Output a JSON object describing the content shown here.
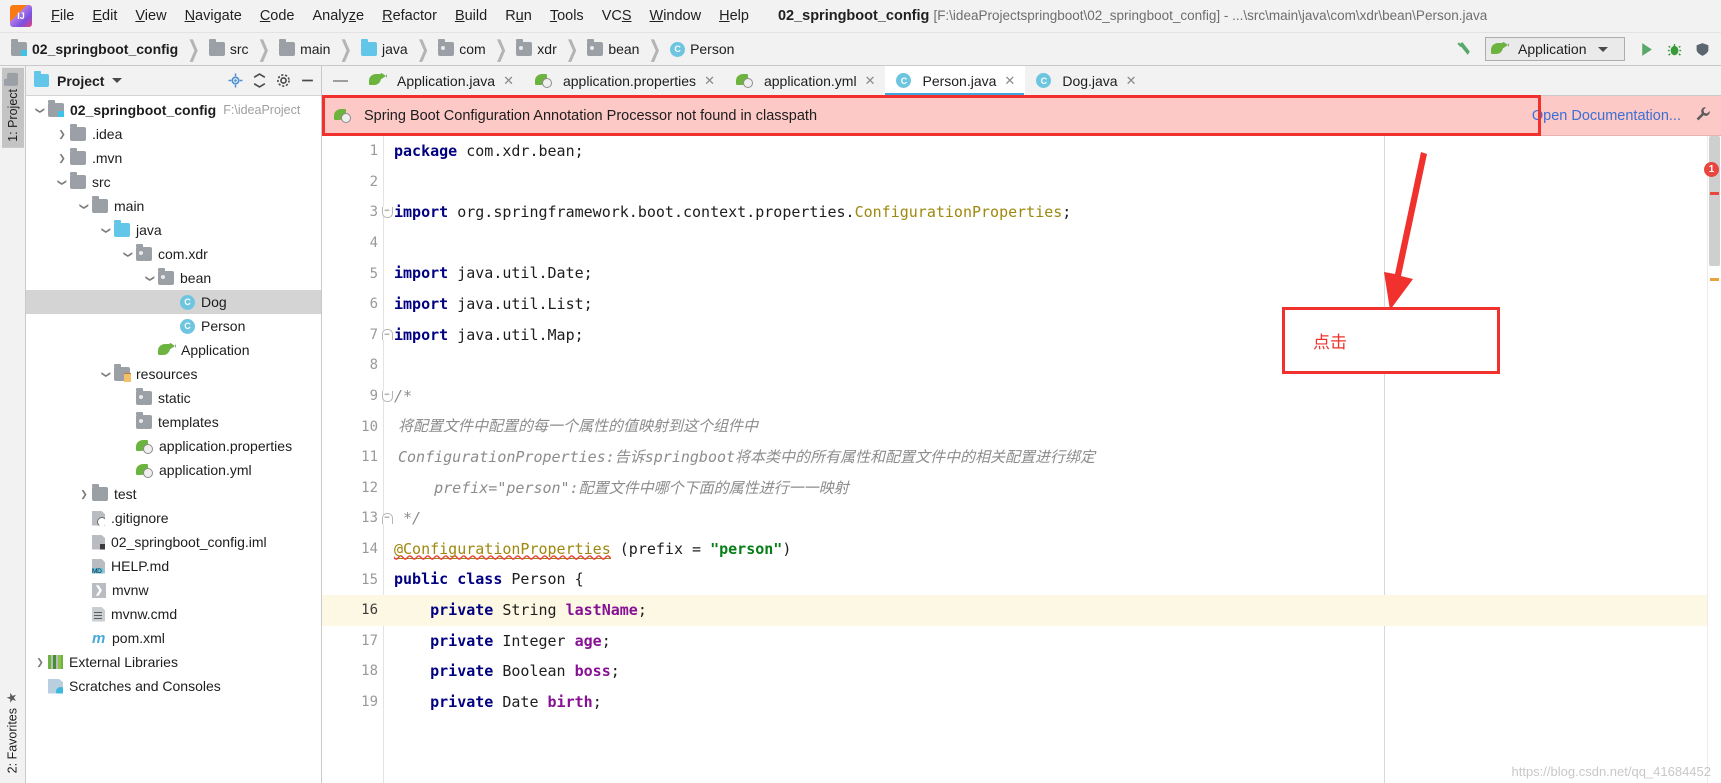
{
  "titlebar": {
    "logo_icon": "intellij-idea-logo",
    "menus": [
      {
        "label": "File",
        "mnemonic": "F"
      },
      {
        "label": "Edit",
        "mnemonic": "E"
      },
      {
        "label": "View",
        "mnemonic": "V"
      },
      {
        "label": "Navigate",
        "mnemonic": "N"
      },
      {
        "label": "Code",
        "mnemonic": "C"
      },
      {
        "label": "Analyze",
        "mnemonic": "z"
      },
      {
        "label": "Refactor",
        "mnemonic": "R"
      },
      {
        "label": "Build",
        "mnemonic": "B"
      },
      {
        "label": "Run",
        "mnemonic": "u"
      },
      {
        "label": "Tools",
        "mnemonic": "T"
      },
      {
        "label": "VCS",
        "mnemonic": "S"
      },
      {
        "label": "Window",
        "mnemonic": "W"
      },
      {
        "label": "Help",
        "mnemonic": "H"
      }
    ],
    "project_name": "02_springboot_config",
    "window_path": "[F:\\ideaProjectspringboot\\02_springboot_config] - ...\\src\\main\\java\\com\\xdr\\bean\\Person.java"
  },
  "breadcrumb": [
    {
      "label": "02_springboot_config",
      "icon": "source-root-folder-icon",
      "bold": true
    },
    {
      "label": "src",
      "icon": "folder-icon",
      "bold": false
    },
    {
      "label": "main",
      "icon": "folder-icon",
      "bold": false
    },
    {
      "label": "java",
      "icon": "source-folder-icon",
      "bold": false
    },
    {
      "label": "com",
      "icon": "package-icon",
      "bold": false
    },
    {
      "label": "xdr",
      "icon": "package-icon",
      "bold": false
    },
    {
      "label": "bean",
      "icon": "package-icon",
      "bold": false
    },
    {
      "label": "Person",
      "icon": "java-class-icon",
      "bold": false
    }
  ],
  "toolbar": {
    "build_icon": "hammer-icon",
    "run_config_label": "Application",
    "run_config_icon": "spring-boot-run-icon",
    "run_icon": "run-play-icon",
    "debug_icon": "debug-bug-icon",
    "coverage_icon": "coverage-shield-icon"
  },
  "project_panel": {
    "title": "Project",
    "title_chevron": "chevron-down-icon",
    "header_icons": [
      "locate-target-icon",
      "collapse-all-icon",
      "settings-gear-icon",
      "hide-minus-icon"
    ],
    "tree": [
      {
        "label": "02_springboot_config",
        "suffix": "F:\\ideaProject",
        "icon": "source-root-folder-icon",
        "twist": "down",
        "indent": 0,
        "bold": true,
        "selected": false
      },
      {
        "label": ".idea",
        "icon": "folder-icon",
        "twist": "right",
        "indent": 1,
        "bold": false,
        "selected": false
      },
      {
        "label": ".mvn",
        "icon": "folder-icon",
        "twist": "right",
        "indent": 1,
        "bold": false,
        "selected": false
      },
      {
        "label": "src",
        "icon": "folder-icon",
        "twist": "down",
        "indent": 1,
        "bold": false,
        "selected": false
      },
      {
        "label": "main",
        "icon": "folder-icon",
        "twist": "down",
        "indent": 2,
        "bold": false,
        "selected": false
      },
      {
        "label": "java",
        "icon": "source-folder-icon",
        "twist": "down",
        "indent": 3,
        "bold": false,
        "selected": false
      },
      {
        "label": "com.xdr",
        "icon": "package-icon",
        "twist": "down",
        "indent": 4,
        "bold": false,
        "selected": false
      },
      {
        "label": "bean",
        "icon": "package-icon",
        "twist": "down",
        "indent": 5,
        "bold": false,
        "selected": false
      },
      {
        "label": "Dog",
        "icon": "java-class-icon",
        "twist": "none",
        "indent": 6,
        "bold": false,
        "selected": true
      },
      {
        "label": "Person",
        "icon": "java-class-icon",
        "twist": "none",
        "indent": 6,
        "bold": false,
        "selected": false
      },
      {
        "label": "Application",
        "icon": "spring-boot-run-icon",
        "twist": "none",
        "indent": 5,
        "bold": false,
        "selected": false
      },
      {
        "label": "resources",
        "icon": "resource-folder-icon",
        "twist": "down",
        "indent": 3,
        "bold": false,
        "selected": false
      },
      {
        "label": "static",
        "icon": "package-icon",
        "twist": "none",
        "indent": 4,
        "bold": false,
        "selected": false
      },
      {
        "label": "templates",
        "icon": "package-icon",
        "twist": "none",
        "indent": 4,
        "bold": false,
        "selected": false
      },
      {
        "label": "application.properties",
        "icon": "spring-config-icon",
        "twist": "none",
        "indent": 4,
        "bold": false,
        "selected": false
      },
      {
        "label": "application.yml",
        "icon": "spring-config-icon",
        "twist": "none",
        "indent": 4,
        "bold": false,
        "selected": false
      },
      {
        "label": "test",
        "icon": "folder-icon",
        "twist": "right",
        "indent": 2,
        "bold": false,
        "selected": false
      },
      {
        "label": ".gitignore",
        "icon": "gitignore-file-icon",
        "twist": "none",
        "indent": 2,
        "bold": false,
        "selected": false
      },
      {
        "label": "02_springboot_config.iml",
        "icon": "iml-file-icon",
        "twist": "none",
        "indent": 2,
        "bold": false,
        "selected": false
      },
      {
        "label": "HELP.md",
        "icon": "markdown-file-icon",
        "twist": "none",
        "indent": 2,
        "bold": false,
        "selected": false
      },
      {
        "label": "mvnw",
        "icon": "shell-script-icon",
        "twist": "none",
        "indent": 2,
        "bold": false,
        "selected": false
      },
      {
        "label": "mvnw.cmd",
        "icon": "cmd-script-icon",
        "twist": "none",
        "indent": 2,
        "bold": false,
        "selected": false
      },
      {
        "label": "pom.xml",
        "icon": "maven-file-icon",
        "twist": "none",
        "indent": 2,
        "bold": false,
        "selected": false
      },
      {
        "label": "External Libraries",
        "icon": "libraries-icon",
        "twist": "right",
        "indent": 0,
        "bold": false,
        "selected": false
      },
      {
        "label": "Scratches and Consoles",
        "icon": "scratches-icon",
        "twist": "none",
        "indent": 0,
        "bold": false,
        "selected": false
      }
    ]
  },
  "tool_window_tabs": {
    "project": "1: Project",
    "favorites": "2: Favorites"
  },
  "editor_tabs": [
    {
      "label": "Application.java",
      "icon": "spring-boot-run-icon",
      "active": false
    },
    {
      "label": "application.properties",
      "icon": "spring-config-icon",
      "active": false
    },
    {
      "label": "application.yml",
      "icon": "spring-config-icon",
      "active": false
    },
    {
      "label": "Person.java",
      "icon": "java-class-icon",
      "active": true
    },
    {
      "label": "Dog.java",
      "icon": "java-class-icon",
      "active": false
    }
  ],
  "warning_banner": {
    "icon": "spring-boot-leaf-icon",
    "message": "Spring Boot Configuration Annotation Processor not found in classpath",
    "link": "Open Documentation...",
    "settings_icon": "wrench-icon"
  },
  "code": {
    "lines": [
      {
        "n": 1,
        "fold": "",
        "highlight": false
      },
      {
        "n": 2,
        "fold": "",
        "highlight": false
      },
      {
        "n": 3,
        "fold": "top",
        "highlight": false
      },
      {
        "n": 4,
        "fold": "",
        "highlight": false
      },
      {
        "n": 5,
        "fold": "",
        "highlight": false
      },
      {
        "n": 6,
        "fold": "",
        "highlight": false
      },
      {
        "n": 7,
        "fold": "bottom",
        "highlight": false
      },
      {
        "n": 8,
        "fold": "",
        "highlight": false
      },
      {
        "n": 9,
        "fold": "top",
        "highlight": false
      },
      {
        "n": 10,
        "fold": "",
        "highlight": false
      },
      {
        "n": 11,
        "fold": "",
        "highlight": false
      },
      {
        "n": 12,
        "fold": "",
        "highlight": false
      },
      {
        "n": 13,
        "fold": "bottom",
        "highlight": false
      },
      {
        "n": 14,
        "fold": "",
        "highlight": false
      },
      {
        "n": 15,
        "fold": "",
        "highlight": false
      },
      {
        "n": 16,
        "fold": "",
        "highlight": true
      },
      {
        "n": 17,
        "fold": "",
        "highlight": false
      },
      {
        "n": 18,
        "fold": "",
        "highlight": false
      },
      {
        "n": 19,
        "fold": "",
        "highlight": false
      }
    ],
    "text": {
      "l1_kw": "package",
      "l1_rest": " com.xdr.bean;",
      "l3_kw": "import",
      "l3_rest": " org.springframework.boot.context.properties.",
      "l3_cls": "ConfigurationProperties",
      "l3_end": ";",
      "l5_kw": "import",
      "l5_rest": " java.util.Date;",
      "l6_kw": "import",
      "l6_rest": " java.util.List;",
      "l7_kw": "import",
      "l7_rest": " java.util.Map;",
      "l9": "/*",
      "l10": "将配置文件中配置的每一个属性的值映射到这个组件中",
      "l11": "ConfigurationProperties:告诉springboot将本类中的所有属性和配置文件中的相关配置进行绑定",
      "l12": "    prefix=\"person\":配置文件中哪个下面的属性进行一一映射",
      "l13": " */",
      "l14_anno": "@ConfigurationProperties",
      "l14_mid": " (prefix = ",
      "l14_str": "\"person\"",
      "l14_end": ")",
      "l15_kw1": "public",
      "l15_kw2": "class",
      "l15_name": " Person {",
      "l16_kw": "private",
      "l16_type": " String ",
      "l16_field": "lastName",
      "l16_end": ";",
      "l17_kw": "private",
      "l17_type": " Integer ",
      "l17_field": "age",
      "l17_end": ";",
      "l18_kw": "private",
      "l18_type": " Boolean ",
      "l18_field": "boss",
      "l18_end": ";",
      "l19_kw": "private",
      "l19_type": " Date ",
      "l19_field": "birth",
      "l19_end": ";"
    }
  },
  "inspection_gutter": {
    "error_count": "1"
  },
  "annotations": {
    "note_text": "点击",
    "arrow_icon": "red-arrow-down-icon",
    "banner_box_icon": "red-highlight-box",
    "accent_red": "#f0312d"
  },
  "watermark": "https://blog.csdn.net/qq_41684452"
}
